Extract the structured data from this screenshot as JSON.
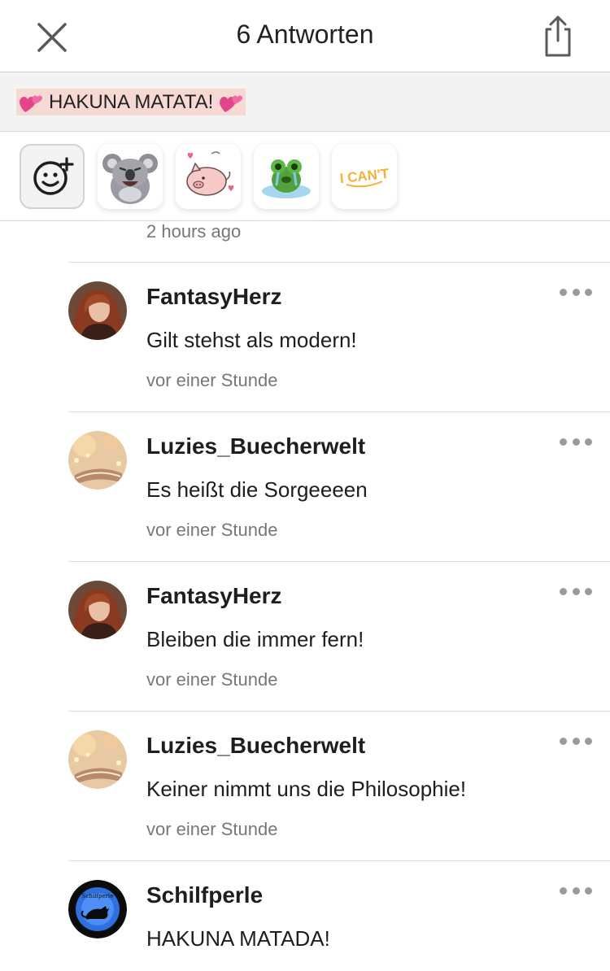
{
  "header": {
    "title": "6 Antworten",
    "close_icon": "close-icon",
    "share_icon": "share-icon"
  },
  "quote": {
    "text": "HAKUNA MATATA!",
    "highlight_color": "#f5d9d2",
    "decoration_icon": "two-hearts-icon"
  },
  "stickers": {
    "add_icon": "add-emoji-icon",
    "items": [
      {
        "name": "koala-laughing-sticker"
      },
      {
        "name": "pig-hearts-sticker"
      },
      {
        "name": "frog-crying-sticker"
      },
      {
        "name": "i-cant-sticker",
        "text": "I CAN'T"
      }
    ]
  },
  "previous_time": "2 hours ago",
  "comments": [
    {
      "author": "FantasyHerz",
      "text": "Gilt stehst als modern!",
      "time": "vor einer Stunde",
      "avatar": "portrait-red-hair"
    },
    {
      "author": "Luzies_Buecherwelt",
      "text": "Es heißt die Sorgeeeen",
      "time": "vor einer Stunde",
      "avatar": "book-lights"
    },
    {
      "author": "FantasyHerz",
      "text": "Bleiben die immer fern!",
      "time": "vor einer Stunde",
      "avatar": "portrait-red-hair"
    },
    {
      "author": "Luzies_Buecherwelt",
      "text": "Keiner nimmt uns die Philosophie!",
      "time": "vor einer Stunde",
      "avatar": "book-lights"
    },
    {
      "author": "Schilfperle",
      "text": "HAKUNA MATADA!",
      "time": "",
      "avatar": "blue-circle-cat",
      "avatar_text": "Schilfperle"
    }
  ],
  "colors": {
    "divider": "#dcdcdc",
    "muted_text": "#777777",
    "more_dots": "#a09a97"
  }
}
